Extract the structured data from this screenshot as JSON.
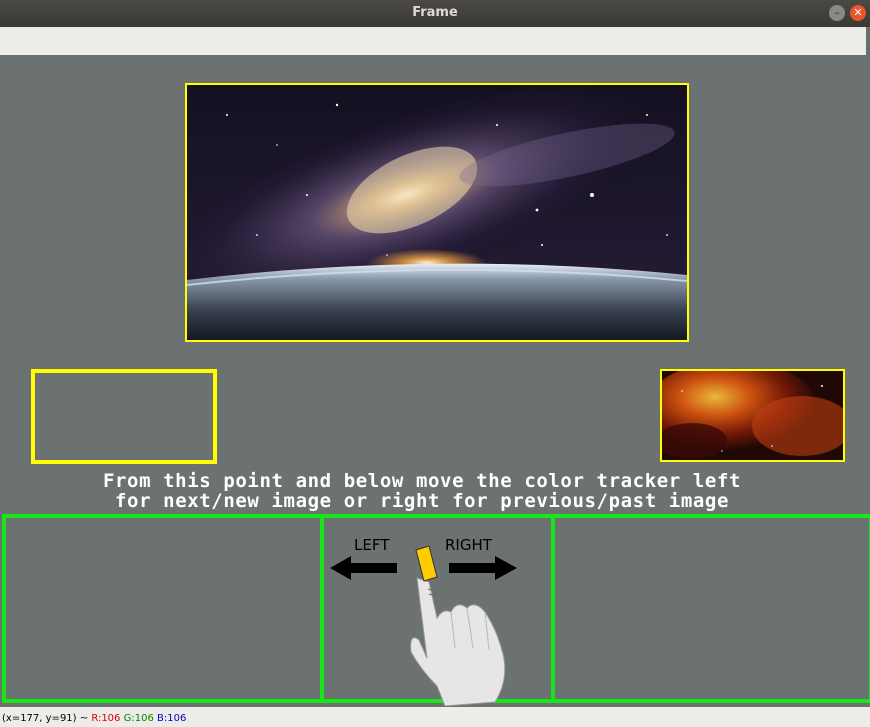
{
  "window": {
    "title": "Frame"
  },
  "instructions": {
    "line1": "From this point and below move the color tracker left",
    "line2": "for next/new image or right for previous/past image"
  },
  "gesture": {
    "left_label": "LEFT",
    "right_label": "RIGHT"
  },
  "status": {
    "coords": "(x=177, y=91) ~",
    "r": "R:106",
    "g": "G:106",
    "b": "B:106"
  },
  "colors": {
    "frame_border": "#ffff00",
    "zone_border": "#19e619",
    "background": "#6c7171",
    "tracker": "#ffcc00"
  },
  "icons": [
    "minimize-icon",
    "close-icon",
    "hand-pointer-icon",
    "arrow-left-icon",
    "arrow-right-icon"
  ]
}
